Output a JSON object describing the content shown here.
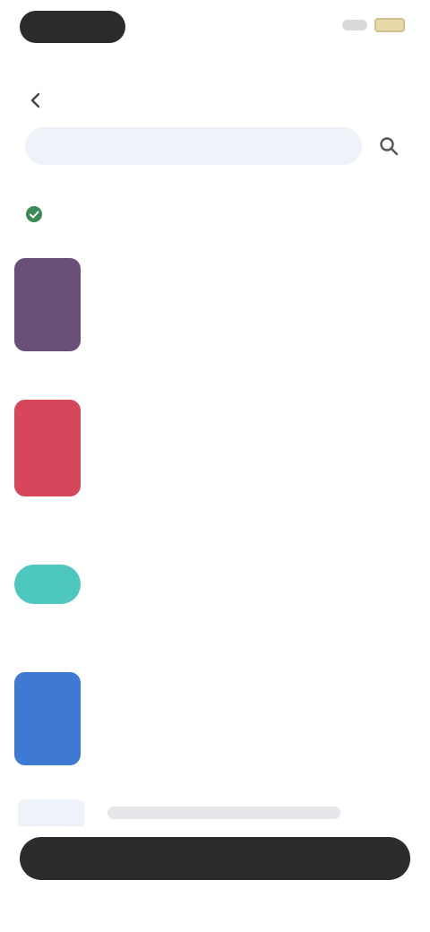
{
  "colors": {
    "verified": "#3c8a56",
    "thumb_1": "#6a4f78",
    "thumb_2": "#d7475c",
    "thumb_3": "#4ec7be",
    "thumb_4": "#3e7ad3"
  },
  "header": {
    "back_icon": "chevron-left-icon",
    "title": ""
  },
  "search": {
    "value": "",
    "placeholder": "",
    "icon": "search-icon"
  },
  "verified": {
    "icon": "check-circle-icon",
    "label": ""
  },
  "results": [
    {
      "title": "",
      "meta": ""
    },
    {
      "title": "",
      "meta": ""
    },
    {
      "title": "",
      "meta": ""
    },
    {
      "title": "",
      "meta": ""
    }
  ],
  "bottom_bar": {
    "label": ""
  }
}
